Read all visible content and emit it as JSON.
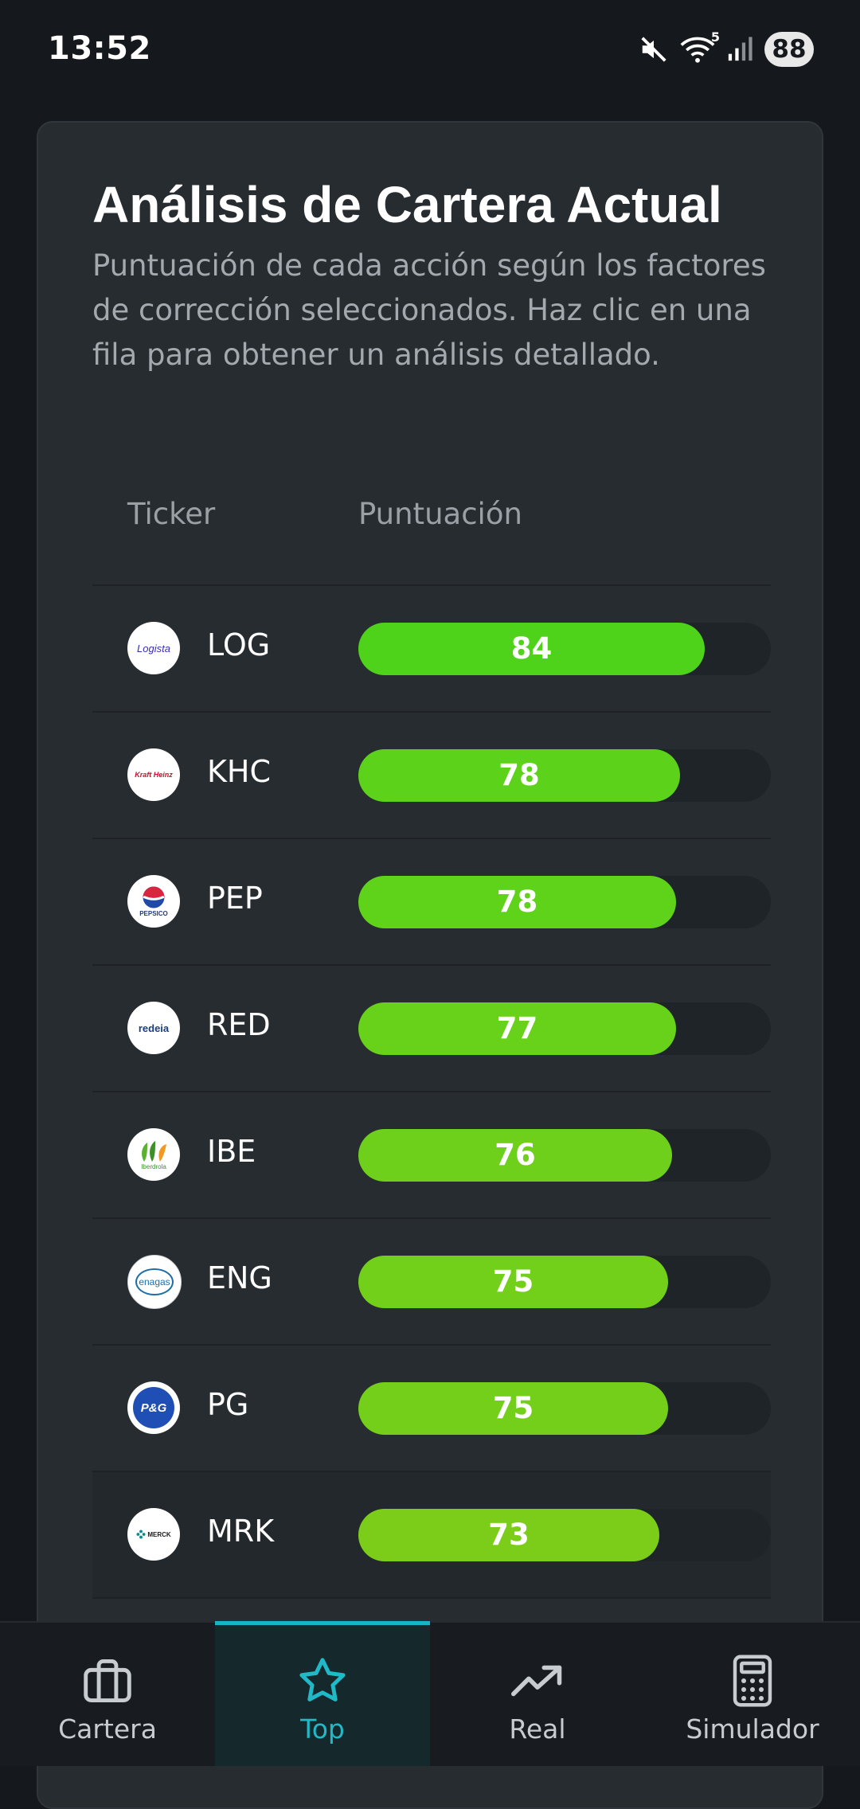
{
  "status_bar": {
    "time": "13:52",
    "icons": [
      "mute-icon",
      "wifi-icon",
      "signal-icon"
    ],
    "wifi_badge": "5",
    "battery": "88"
  },
  "card": {
    "title": "Análisis de Cartera Actual",
    "description": "Puntuación de cada acción según los factores de corrección seleccionados. Haz clic en una fila para obtener un análisis detallado."
  },
  "table": {
    "headers": {
      "ticker": "Ticker",
      "score": "Puntuación"
    },
    "max_score": 100,
    "rows": [
      {
        "ticker": "LOG",
        "score": 84,
        "logo_text": "Logista",
        "color": "#4ed21a",
        "fill_fraction": 0.84
      },
      {
        "ticker": "KHC",
        "score": 78,
        "logo_text": "Kraft Heinz",
        "color": "#5dd21a",
        "fill_fraction": 0.78
      },
      {
        "ticker": "PEP",
        "score": 78,
        "logo_text": "PEPSICO",
        "color": "#5fd21a",
        "fill_fraction": 0.77
      },
      {
        "ticker": "RED",
        "score": 77,
        "logo_text": "redeia",
        "color": "#68d11a",
        "fill_fraction": 0.77
      },
      {
        "ticker": "IBE",
        "score": 76,
        "logo_text": "Iberdrola",
        "color": "#6ed01a",
        "fill_fraction": 0.76
      },
      {
        "ticker": "ENG",
        "score": 75,
        "logo_text": "enagas",
        "color": "#72d01a",
        "fill_fraction": 0.75
      },
      {
        "ticker": "PG",
        "score": 75,
        "logo_text": "P&G",
        "color": "#74cf1a",
        "fill_fraction": 0.75
      },
      {
        "ticker": "MRK",
        "score": 73,
        "logo_text": "MERCK",
        "color": "#7ccd1a",
        "fill_fraction": 0.73
      }
    ]
  },
  "nav": {
    "items": [
      {
        "label": "Cartera",
        "icon": "briefcase-icon",
        "active": false
      },
      {
        "label": "Top",
        "icon": "star-icon",
        "active": true
      },
      {
        "label": "Real",
        "icon": "trending-up-icon",
        "active": false
      },
      {
        "label": "Simulador",
        "icon": "calculator-icon",
        "active": false
      }
    ]
  },
  "colors": {
    "background": "#15181c",
    "card": "#272c31",
    "accent": "#16b5c4",
    "score_green": "#4fcf1a"
  }
}
